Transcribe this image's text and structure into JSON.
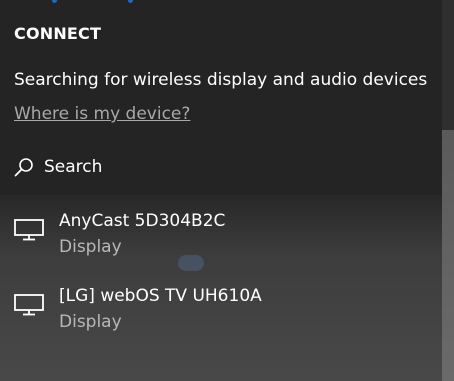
{
  "panel": {
    "title": "CONNECT",
    "status": "Searching for wireless display and audio devices",
    "help_link": "Where is my device?"
  },
  "search": {
    "label": "Search",
    "icon": "search-icon"
  },
  "devices": [
    {
      "name": "AnyCast 5D304B2C",
      "type": "Display",
      "icon": "monitor-icon"
    },
    {
      "name": "[LG] webOS TV UH610A",
      "type": "Display",
      "icon": "monitor-icon"
    }
  ],
  "colors": {
    "panel_bg": "#242424",
    "text": "#ffffff",
    "secondary_text": "#b8b8b8",
    "link_text": "#a8a8a8",
    "accent": "#1f66c9"
  }
}
